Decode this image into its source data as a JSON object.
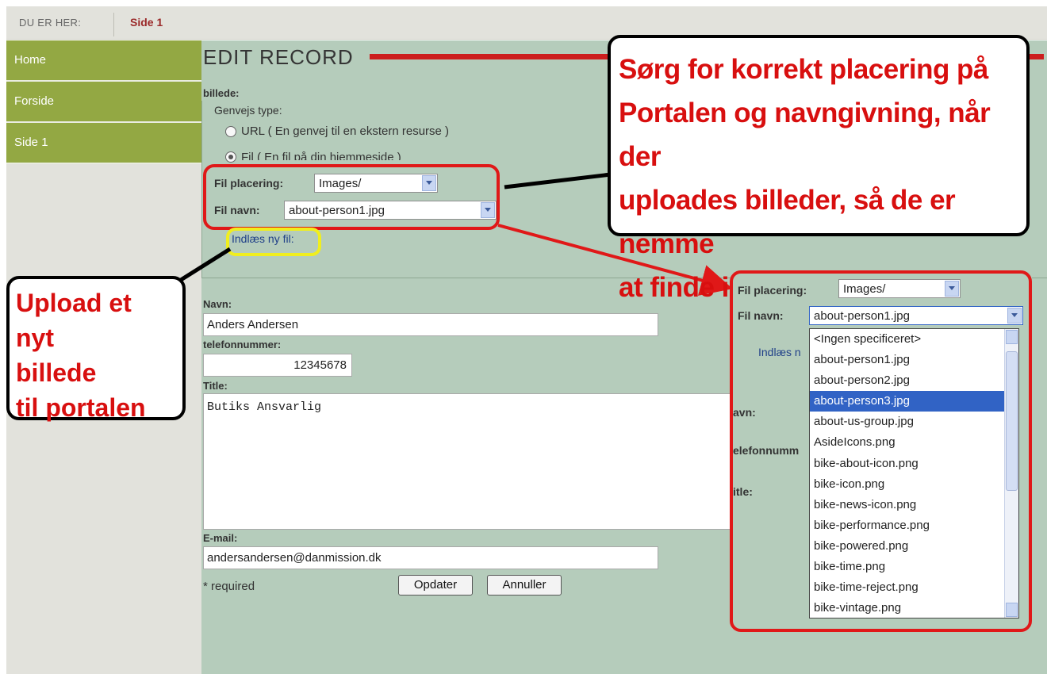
{
  "breadcrumb": {
    "label": "DU ER HER:",
    "current": "Side 1"
  },
  "sidebar": {
    "items": [
      {
        "label": "Home"
      },
      {
        "label": "Forside"
      },
      {
        "label": "Side 1"
      }
    ]
  },
  "page": {
    "title": "EDIT RECORD"
  },
  "form": {
    "billede_label": "billede:",
    "genvejs_type_label": "Genvejs type:",
    "radio_url": "URL ( En genvej til en ekstern resurse )",
    "radio_fil": "Fil ( En fil på din hjemmeside )",
    "fil_placering_label": "Fil placering:",
    "fil_placering_value": "Images/",
    "fil_navn_label": "Fil navn:",
    "fil_navn_value": "about-person1.jpg",
    "upload_link": "Indlæs ny fil:",
    "navn_label": "Navn:",
    "navn_value": "Anders Andersen",
    "telefon_label": "telefonnummer:",
    "telefon_value": "12345678",
    "title_label": "Title:",
    "title_value": "Butiks Ansvarlig",
    "email_label": "E-mail:",
    "email_value": "andersandersen@danmission.dk",
    "required_note": "* required",
    "update_button": "Opdater",
    "cancel_button": "Annuller"
  },
  "annotations": {
    "top_line1": "Sørg for korrekt placering på",
    "top_line2": "Portalen og navngivning, når der",
    "top_line3": "uploades billeder, så de er nemme",
    "top_line4": "at finde igen!",
    "left_line1": "Upload et nyt",
    "left_line2": "billede",
    "left_line3": "til portalen"
  },
  "popout": {
    "fil_placering_label": "Fil placering:",
    "fil_placering_value": "Images/",
    "fil_navn_label": "Fil navn:",
    "fil_navn_value": "about-person1.jpg",
    "upload_link": "Indlæs n",
    "navn_label": "avn:",
    "telefon_label": "elefonnumm",
    "title_label": "itle:",
    "dropdown_options": [
      "<Ingen specificeret>",
      "about-person1.jpg",
      "about-person2.jpg",
      "about-person3.jpg",
      "about-us-group.jpg",
      "AsideIcons.png",
      "bike-about-icon.png",
      "bike-icon.png",
      "bike-news-icon.png",
      "bike-performance.png",
      "bike-powered.png",
      "bike-time.png",
      "bike-time-reject.png",
      "bike-vintage.png"
    ],
    "selected_option": "about-person3.jpg"
  },
  "colors": {
    "accent_red": "#cc1e1e",
    "nav_green": "#93a843",
    "panel_green": "#b5ccbb",
    "selection_blue": "#3163c5"
  }
}
